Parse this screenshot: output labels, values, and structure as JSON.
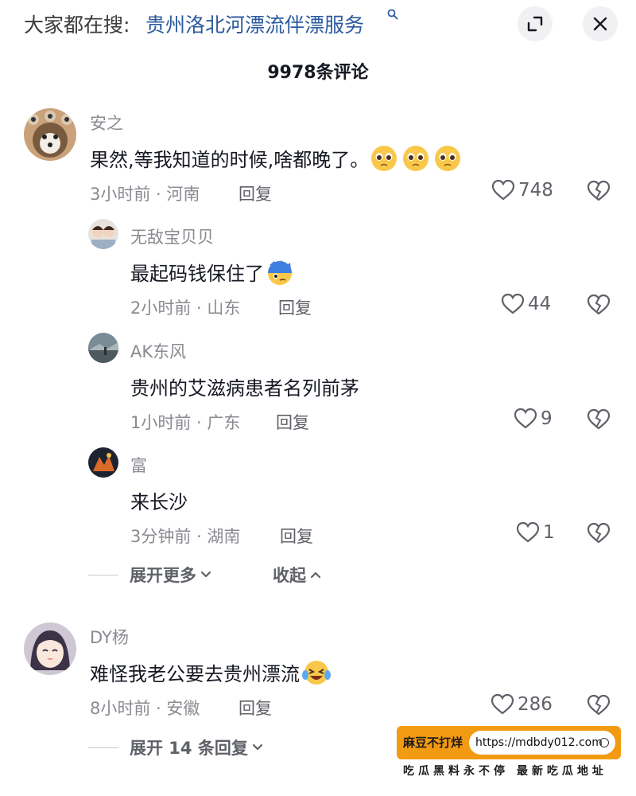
{
  "header": {
    "search_prefix": "大家都在搜:",
    "search_term": "贵州洛北河漂流伴漂服务",
    "search_icon": "search-icon",
    "expand_icon": "expand-icon",
    "close_icon": "close-icon"
  },
  "comment_count": "9978条评论",
  "comments": [
    {
      "name": "安之",
      "text": "果然,等我知道的时候,啥都晚了。",
      "emoji": "pleading-face-emoji x3",
      "meta": "3小时前 · 河南",
      "reply_label": "回复",
      "likes": "748",
      "replies": [
        {
          "name": "无敌宝贝贝",
          "text": "最起码钱保住了",
          "emoji": "cold-sweat-face-emoji",
          "meta": "2小时前 · 山东",
          "reply_label": "回复",
          "likes": "44"
        },
        {
          "name": "AK东风",
          "text": "贵州的艾滋病患者名列前茅",
          "meta": "1小时前 · 广东",
          "reply_label": "回复",
          "likes": "9"
        },
        {
          "name": "富",
          "text": "来长沙",
          "meta": "3分钟前 · 湖南",
          "reply_label": "回复",
          "likes": "1"
        }
      ],
      "expand_more": "展开更多",
      "collapse": "收起"
    },
    {
      "name": "DY杨",
      "text": "难怪我老公要去贵州漂流",
      "emoji": "crying-laughing-face-emoji",
      "meta": "8小时前 · 安徽",
      "reply_label": "回复",
      "likes": "286",
      "expand_replies": "展开 14 条回复"
    }
  ],
  "promo": {
    "label": "麻豆不打烊",
    "url": "https://mdbdy012.com",
    "tagline": "吃瓜黑料永不停 最新吃瓜地址"
  }
}
